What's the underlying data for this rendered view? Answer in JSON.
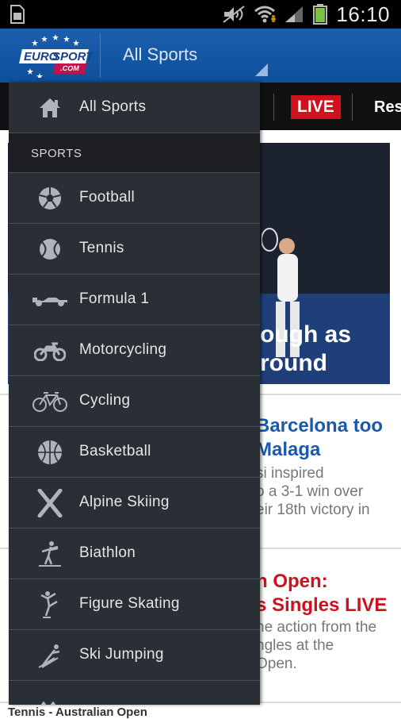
{
  "status_bar": {
    "time": "16:10",
    "battery_icon": "battery-icon",
    "signal_icon": "signal-icon",
    "wifi_icon": "wifi-icon"
  },
  "action_bar": {
    "logo": {
      "euro": "EURO",
      "sport": "SPORT",
      "domain": ".COM"
    },
    "title": "All Sports"
  },
  "tabs": {
    "live_label": "LIVE",
    "results_label": "Resu"
  },
  "background": {
    "hero_headline": "ough as\nround",
    "story1_title": "Barcelona too\nMalaga",
    "story1_text": "si inspired\no a 3-1 win over\neir 18th victory in",
    "story2_title": "n Open:\ns Singles LIVE",
    "story2_text": "he action from the\nngles at the\nOpen.",
    "footer": "Tennis - Australian Open"
  },
  "drawer": {
    "all_sports_label": "All Sports",
    "section_header": "SPORTS",
    "items": [
      {
        "label": "Football",
        "icon": "football-icon"
      },
      {
        "label": "Tennis",
        "icon": "tennis-ball-icon"
      },
      {
        "label": "Formula 1",
        "icon": "f1-car-icon"
      },
      {
        "label": "Motorcycling",
        "icon": "motorcycle-icon"
      },
      {
        "label": "Cycling",
        "icon": "bicycle-icon"
      },
      {
        "label": "Basketball",
        "icon": "basketball-icon"
      },
      {
        "label": "Alpine Skiing",
        "icon": "skis-icon"
      },
      {
        "label": "Biathlon",
        "icon": "biathlon-icon"
      },
      {
        "label": "Figure Skating",
        "icon": "figure-skater-icon"
      },
      {
        "label": "Ski Jumping",
        "icon": "ski-jumper-icon"
      }
    ]
  },
  "colors": {
    "action_bar": "#1a5fae",
    "drawer_bg": "#2a2e35",
    "live_red": "#d0101e",
    "headline_blue": "#1a5aa8",
    "headline_red": "#d0101e"
  }
}
